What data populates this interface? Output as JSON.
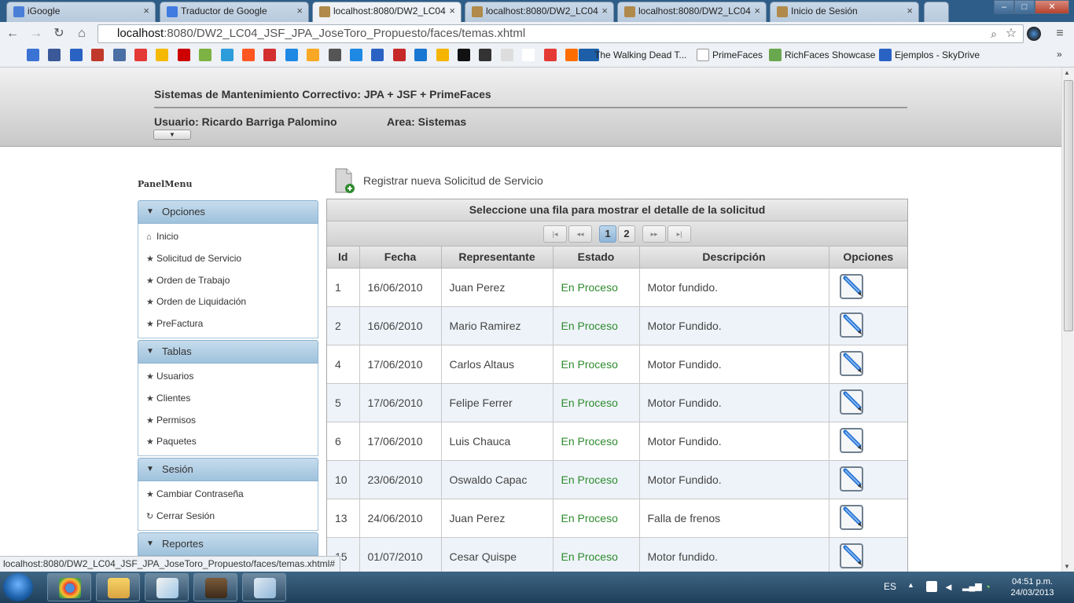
{
  "browser": {
    "tabs": [
      {
        "title": "iGoogle",
        "color": "#4a7fd8"
      },
      {
        "title": "Traductor de Google",
        "color": "#3f7be0"
      },
      {
        "title": "localhost:8080/DW2_LC04",
        "color": "#b08a4a"
      },
      {
        "title": "localhost:8080/DW2_LC04",
        "color": "#b08a4a"
      },
      {
        "title": "localhost:8080/DW2_LC04",
        "color": "#b08a4a"
      },
      {
        "title": "Inicio de Sesión",
        "color": "#b08a4a"
      }
    ],
    "url_host": "localhost",
    "url_rest": ":8080/DW2_LC04_JSF_JPA_JoseToro_Propuesto/faces/temas.xhtml",
    "bookmarks": [
      {
        "label": "The Walking Dead T...",
        "color": "#1c5fa8"
      },
      {
        "label": "PrimeFaces",
        "color": "#ffffff"
      },
      {
        "label": "RichFaces Showcase",
        "color": "#6aa84f"
      },
      {
        "label": "Ejemplos - SkyDrive",
        "color": "#2a62c4"
      }
    ],
    "status_url": "localhost:8080/DW2_LC04_JSF_JPA_JoseToro_Propuesto/faces/temas.xhtml#"
  },
  "header": {
    "title": "Sistemas de Mantenimiento Correctivo: JPA + JSF + PrimeFaces",
    "user": "Usuario: Ricardo Barriga Palomino",
    "area": "Area: Sistemas",
    "dropdown_icon": "▼"
  },
  "panel_menu": {
    "title": "PanelMenu",
    "sections": [
      {
        "label": "Opciones",
        "items": [
          {
            "label": "Inicio",
            "icon": "⌂"
          },
          {
            "label": "Solicitud de Servicio",
            "icon": "★"
          },
          {
            "label": "Orden de Trabajo",
            "icon": "★"
          },
          {
            "label": "Orden de Liquidación",
            "icon": "★"
          },
          {
            "label": "PreFactura",
            "icon": "★"
          }
        ]
      },
      {
        "label": "Tablas",
        "items": [
          {
            "label": "Usuarios",
            "icon": "★"
          },
          {
            "label": "Clientes",
            "icon": "★"
          },
          {
            "label": "Permisos",
            "icon": "★"
          },
          {
            "label": "Paquetes",
            "icon": "★"
          }
        ]
      },
      {
        "label": "Sesión",
        "items": [
          {
            "label": "Cambiar Contraseña",
            "icon": "★"
          },
          {
            "label": "Cerrar Sesión",
            "icon": "↻"
          }
        ]
      },
      {
        "label": "Reportes",
        "items": []
      }
    ]
  },
  "main": {
    "register_label": "Registrar nueva Solicitud de Servicio",
    "grid_caption": "Seleccione una fila para mostrar el detalle de la solicitud",
    "paginator": {
      "first": "|◂",
      "prev": "◂◂",
      "pages": [
        "1",
        "2"
      ],
      "current": "1",
      "next": "▸▸",
      "last": "▸|"
    },
    "columns": [
      "Id",
      "Fecha",
      "Representante",
      "Estado",
      "Descripción",
      "Opciones"
    ],
    "rows": [
      {
        "id": "1",
        "fecha": "16/06/2010",
        "representante": "Juan Perez",
        "estado": "En Proceso",
        "descripcion": "Motor fundido."
      },
      {
        "id": "2",
        "fecha": "16/06/2010",
        "representante": "Mario Ramirez",
        "estado": "En Proceso",
        "descripcion": "Motor Fundido."
      },
      {
        "id": "4",
        "fecha": "17/06/2010",
        "representante": "Carlos Altaus",
        "estado": "En Proceso",
        "descripcion": "Motor Fundido."
      },
      {
        "id": "5",
        "fecha": "17/06/2010",
        "representante": "Felipe Ferrer",
        "estado": "En Proceso",
        "descripcion": "Motor Fundido."
      },
      {
        "id": "6",
        "fecha": "17/06/2010",
        "representante": "Luis Chauca",
        "estado": "En Proceso",
        "descripcion": "Motor Fundido."
      },
      {
        "id": "10",
        "fecha": "23/06/2010",
        "representante": "Oswaldo Capac",
        "estado": "En Proceso",
        "descripcion": "Motor Fundido."
      },
      {
        "id": "13",
        "fecha": "24/06/2010",
        "representante": "Juan Perez",
        "estado": "En Proceso",
        "descripcion": "Falla de frenos"
      },
      {
        "id": "15",
        "fecha": "01/07/2010",
        "representante": "Cesar Quispe",
        "estado": "En Proceso",
        "descripcion": "Motor fundido."
      }
    ]
  },
  "taskbar": {
    "lang": "ES",
    "time": "04:51 p.m.",
    "date": "24/03/2013"
  }
}
